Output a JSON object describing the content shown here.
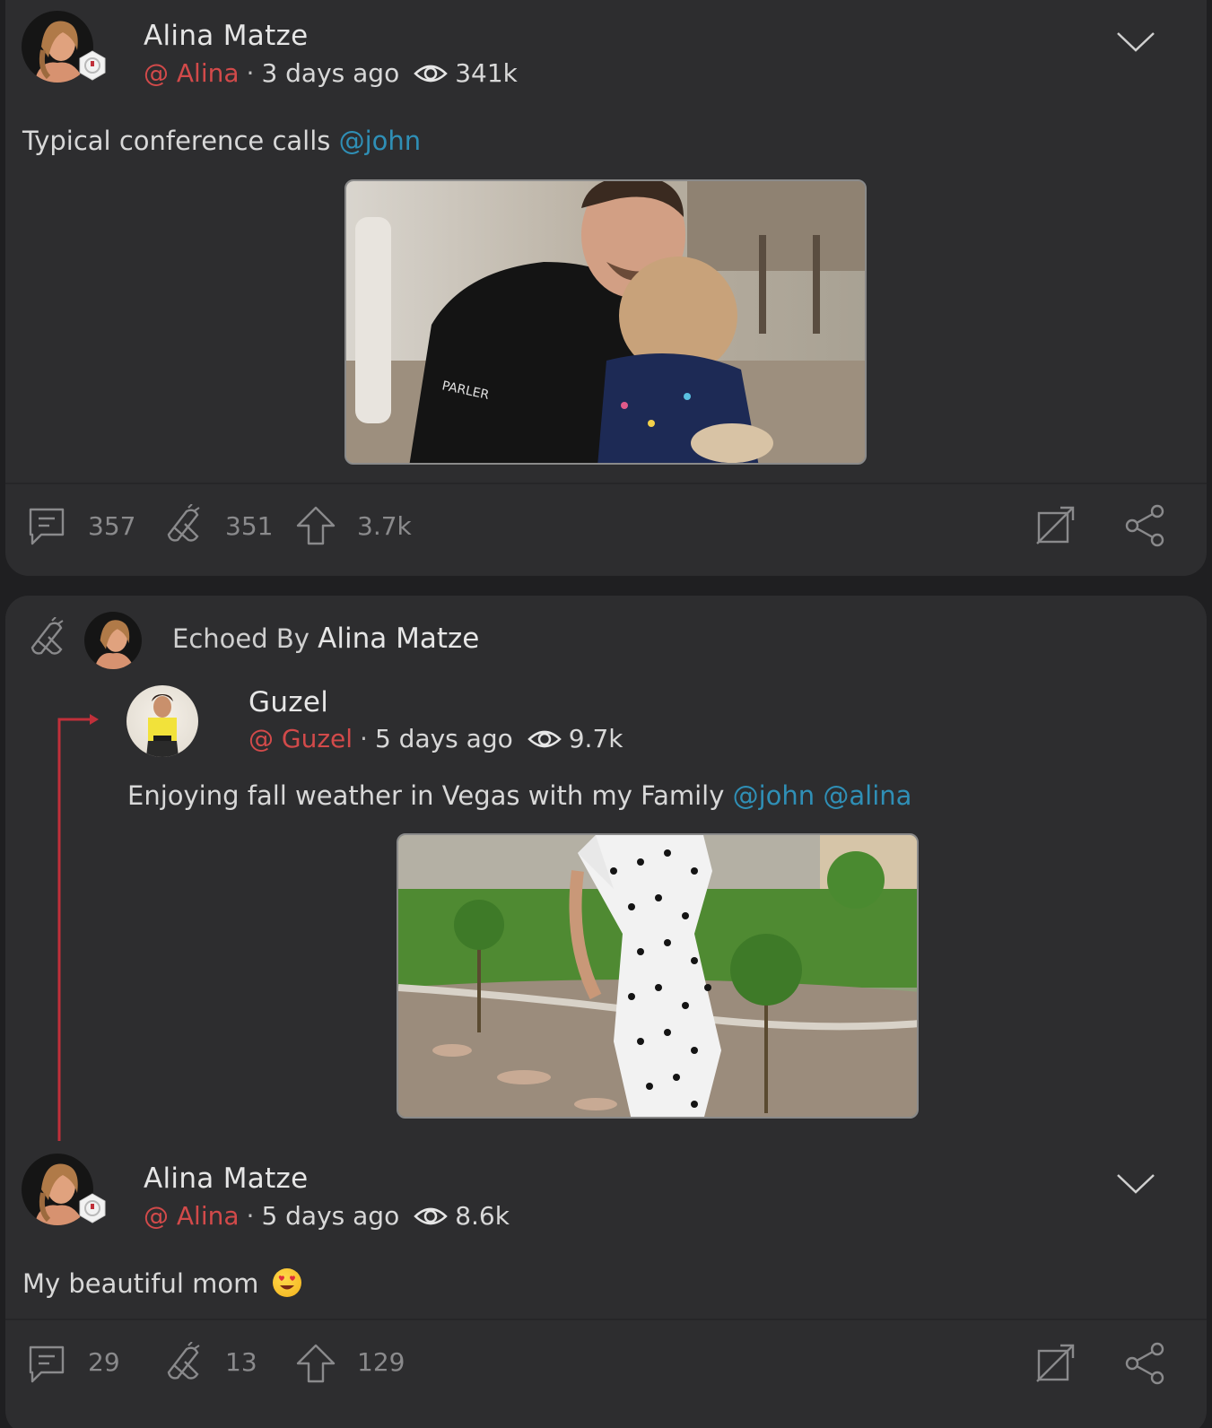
{
  "posts": [
    {
      "author_name": "Alina Matze",
      "handle": "@ Alina",
      "time": "3 days ago",
      "views": "341k",
      "caption_text": "Typical conference calls ",
      "caption_mentions": "@john",
      "image_desc": "Photo: man in black Parler t-shirt holding a young girl",
      "image_text": "PARLER",
      "counts": {
        "comments": "357",
        "echoes": "351",
        "upvotes": "3.7k"
      }
    }
  ],
  "echo": {
    "label": "Echoed By ",
    "echoer_name": "Alina Matze",
    "original": {
      "author_name": "Guzel",
      "handle": "@ Guzel",
      "time": "5 days ago",
      "views": "9.7k",
      "caption_text": "Enjoying fall weather in Vegas with my Family ",
      "caption_mentions": "@john @alina"
    },
    "reply": {
      "author_name": "Alina Matze",
      "handle": "@ Alina",
      "time": "5 days ago",
      "views": "8.6k",
      "caption_text": "My beautiful mom ",
      "emoji": "heart-eyes-emoji"
    },
    "counts": {
      "comments": "29",
      "echoes": "13",
      "upvotes": "129"
    }
  },
  "colors": {
    "handle": "#d24a4a",
    "mention": "#2f8fb6",
    "card": "#2d2d2f",
    "thread_line": "#c0303a"
  },
  "icons": [
    "chevron-down-icon",
    "eye-icon",
    "comment-icon",
    "echo-icon",
    "upvote-icon",
    "expand-icon",
    "share-icon",
    "verified-badge-icon"
  ]
}
